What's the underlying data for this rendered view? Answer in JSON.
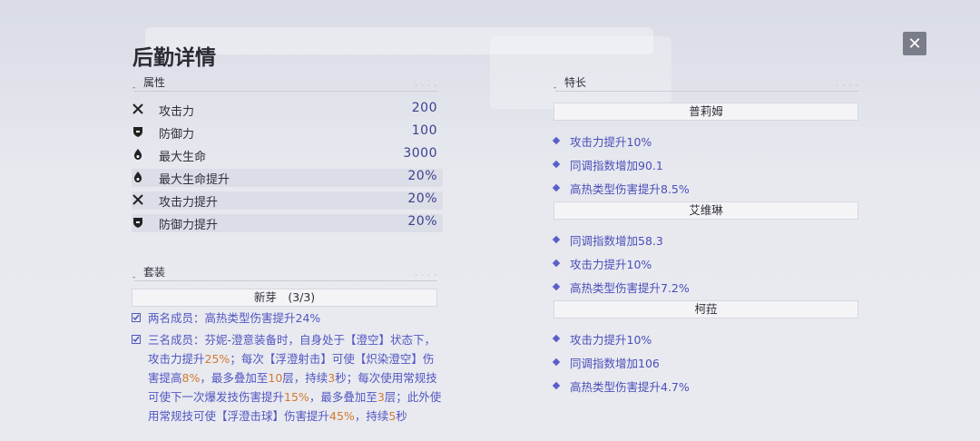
{
  "header": {
    "title": "后勤详情",
    "close_icon": "close-icon"
  },
  "attributes": {
    "heading": "属性",
    "rows": [
      {
        "icon": "attack-icon",
        "label": "攻击力",
        "value": "200",
        "shaded": false
      },
      {
        "icon": "shield-icon",
        "label": "防御力",
        "value": "100",
        "shaded": false
      },
      {
        "icon": "droplet-icon",
        "label": "最大生命",
        "value": "3000",
        "shaded": false
      },
      {
        "icon": "droplet-icon",
        "label": "最大生命提升",
        "value": "20%",
        "shaded": true
      },
      {
        "icon": "attack-icon",
        "label": "攻击力提升",
        "value": "20%",
        "shaded": true
      },
      {
        "icon": "shield-icon",
        "label": "防御力提升",
        "value": "20%",
        "shaded": true
      }
    ]
  },
  "set": {
    "heading": "套装",
    "name": "新芽　(3/3)",
    "two_piece": "两名成员：高热类型伤害提升24%",
    "three_piece_parts": [
      "三名成员：芬妮-澄意装备时，自身处于【澄空】状态下，攻击力提升",
      "25%",
      "；每次【浮澄射击】可使【炽染澄空】伤害提高",
      "8%",
      "，最多叠加至",
      "10",
      "层，持续",
      "3",
      "秒；每次使用常规技可使下一次爆发技伤害提升",
      "15%",
      "，最多叠加至",
      "3",
      "层；此外使用常规技可使【浮澄击球】伤害提升",
      "45%",
      "，持续",
      "5",
      "秒"
    ]
  },
  "specialties": {
    "heading": "特长",
    "groups": [
      {
        "name": "普莉姆",
        "items": [
          "攻击力提升10%",
          "同调指数增加90.1",
          "高热类型伤害提升8.5%"
        ]
      },
      {
        "name": "艾维琳",
        "items": [
          "同调指数增加58.3",
          "攻击力提升10%",
          "高热类型伤害提升7.2%"
        ]
      },
      {
        "name": "柯菈",
        "items": [
          "攻击力提升10%",
          "同调指数增加106",
          "高热类型伤害提升4.7%"
        ]
      }
    ]
  }
}
